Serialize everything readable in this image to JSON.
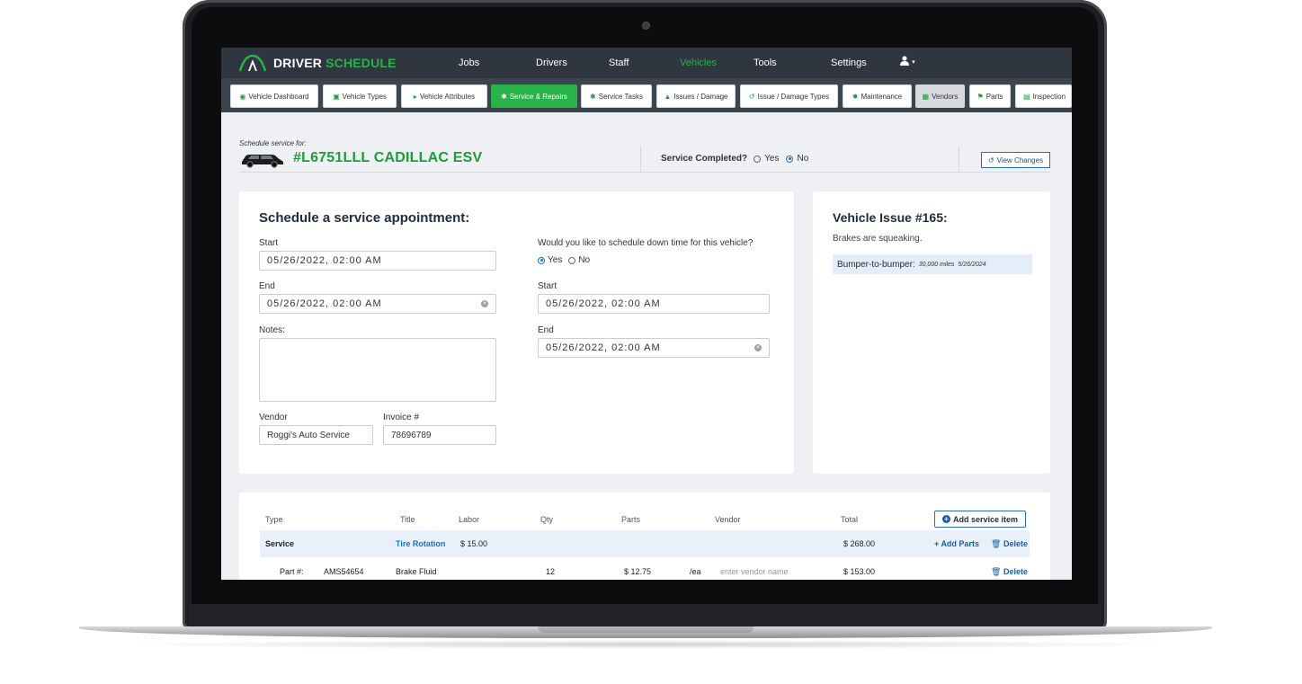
{
  "app": {
    "logo_white": "DRIVER",
    "logo_green": "SCHEDULE",
    "accent": "#27b24a"
  },
  "nav": {
    "items": [
      "Jobs",
      "Drivers",
      "Staff",
      "Vehicles",
      "Tools",
      "Settings"
    ],
    "active": "Vehicles",
    "user_icon": "user-icon"
  },
  "subnav": {
    "tabs": [
      {
        "label": "Vehicle Dashboard",
        "icon": "car-icon"
      },
      {
        "label": "Vehicle Types",
        "icon": "car-icon"
      },
      {
        "label": "Vehicle Attributes",
        "icon": "tag-icon"
      },
      {
        "label": "Service & Repairs",
        "icon": "wrench-icon"
      },
      {
        "label": "Service Tasks",
        "icon": "wrench-icon"
      },
      {
        "label": "Issues / Damage",
        "icon": "warning-icon"
      },
      {
        "label": "Issue / Damage Types",
        "icon": "tools-icon"
      },
      {
        "label": "Maintenance",
        "icon": "gear-icon"
      },
      {
        "label": "Vendors",
        "icon": "building-icon"
      },
      {
        "label": "Parts",
        "icon": "flag-icon"
      },
      {
        "label": "Inspection",
        "icon": "document-icon"
      }
    ],
    "active": "Service & Repairs"
  },
  "header": {
    "schedule_for": "Schedule service for:",
    "vehicle_title": "#L6751LLL CADILLAC ESV",
    "service_completed_label": "Service Completed?",
    "opt_yes": "Yes",
    "opt_no": "No",
    "service_completed_value": "No",
    "view_changes": "View Changes"
  },
  "form": {
    "heading": "Schedule a service appointment:",
    "start_label": "Start",
    "start_value": "05/26/2022, 02:00  AM",
    "end_label": "End",
    "end_value": "05/26/2022, 02:00  AM",
    "notes_label": "Notes:",
    "notes_value": "",
    "vendor_label": "Vendor",
    "vendor_value": "Roggi's Auto Service",
    "invoice_label": "Invoice #",
    "invoice_value": "78696789",
    "downtime_question": "Would you like to schedule down time for this vehicle?",
    "downtime_yes": "Yes",
    "downtime_no": "No",
    "downtime_value": "Yes",
    "dt_start_label": "Start",
    "dt_start_value": "05/26/2022, 02:00  AM",
    "dt_end_label": "End",
    "dt_end_value": "05/26/2022, 02:00  AM"
  },
  "issue": {
    "title": "Vehicle Issue #165:",
    "description": "Brakes are squeaking.",
    "badge_label": "Bumper-to-bumper:",
    "badge_miles": "30,000 miles",
    "badge_date": "5/26/2024"
  },
  "table": {
    "headers": [
      "Type",
      "Title",
      "Labor",
      "Qty",
      "Parts",
      "Vendor",
      "Total"
    ],
    "add_service_item": "Add service item",
    "service_row": {
      "type": "Service",
      "title": "Tire Rotation",
      "labor": "$ 15.00",
      "total": "$ 268.00",
      "add_parts": "Add Parts",
      "delete": "Delete"
    },
    "part_row": {
      "part_label": "Part #:",
      "part_number": "AMS54654",
      "title": "Brake Fluid",
      "qty": "12",
      "parts": "$ 12.75",
      "unit": "/ea",
      "vendor_placeholder": "enter vendor name",
      "total": "$ 153.00",
      "delete": "Delete"
    }
  }
}
